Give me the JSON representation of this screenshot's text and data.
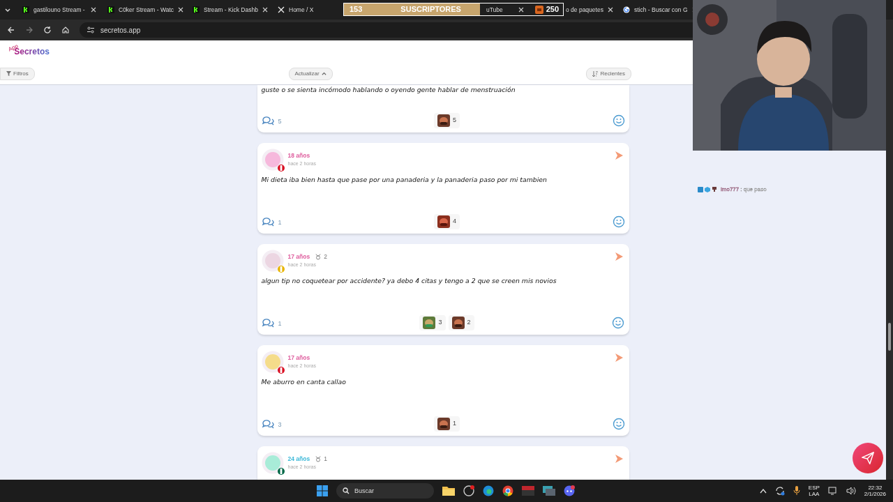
{
  "browser": {
    "tabs": [
      {
        "kind": "kick",
        "label": "gastilouno Stream -"
      },
      {
        "kind": "kick",
        "label": "C0ker Stream - Watc"
      },
      {
        "kind": "kick",
        "label": "Stream - Kick Dashb"
      },
      {
        "kind": "x",
        "label": "Home / X"
      },
      {
        "kind": "hidden",
        "label": "uTube"
      },
      {
        "kind": "hidden",
        "label": "o de paquetes"
      },
      {
        "kind": "google",
        "label": "stich - Buscar con G"
      }
    ],
    "address": "secretos.app"
  },
  "subscriber_goal": {
    "current": "153",
    "label": "SUSCRIPTORES",
    "goal": "250",
    "level": 0.62
  },
  "site": {
    "logo_small": "App",
    "logo": "Secretos",
    "filters": "Filtros",
    "refresh": "Actualizar",
    "sort": "Recientes"
  },
  "posts": [
    {
      "kind": "partial",
      "text": "guste o se sienta incómodo hablando o oyendo gente hablar de menstruación",
      "comments": "5",
      "reactions": [
        {
          "count": "5"
        }
      ]
    },
    {
      "kind": "full",
      "age": "18 años",
      "color": "#de5c9d",
      "time": "hace 2 horas",
      "avatar": {
        "color": "#f6b8dc"
      },
      "flag": {
        "color": "#d91023"
      },
      "text": "Mi dieta iba bien hasta que pase por una panaderia y la panaderia paso por mi tambien",
      "comments": "1",
      "reactions": [
        {
          "count": "4"
        }
      ]
    },
    {
      "kind": "full",
      "age": "17 años",
      "color": "#de5c9d",
      "sign_count": "2",
      "time": "hace 2 horas",
      "avatar": {
        "color": "#ecd6e2"
      },
      "flag": {
        "color": "#e8b400"
      },
      "text": "algun tip no coquetear por accidente? ya debo 4 citas y tengo a 2 que se creen mis novios",
      "comments": "1",
      "reactions": [
        {
          "count": "3"
        },
        {
          "count": "2"
        }
      ]
    },
    {
      "kind": "full",
      "age": "17 años",
      "color": "#de5c9d",
      "time": "hace 2 horas",
      "avatar": {
        "color": "#f5dc8a"
      },
      "flag": {
        "color": "#d91023"
      },
      "text": "Me aburro en canta callao",
      "comments": "3",
      "reactions": [
        {
          "count": "1"
        }
      ]
    },
    {
      "kind": "full",
      "age": "24 años",
      "color": "#3bb8d8",
      "sign_count": "1",
      "time": "hace 2 horas",
      "avatar": {
        "color": "#a8ecd8"
      },
      "flag": {
        "color": "#006847"
      }
    }
  ],
  "chat_overlay": {
    "user": "lmo777",
    "message": ": que paso"
  },
  "taskbar": {
    "search_placeholder": "Buscar",
    "language": "ESP",
    "layout": "LAA",
    "time": "22:32",
    "date": "2/1/2026"
  }
}
